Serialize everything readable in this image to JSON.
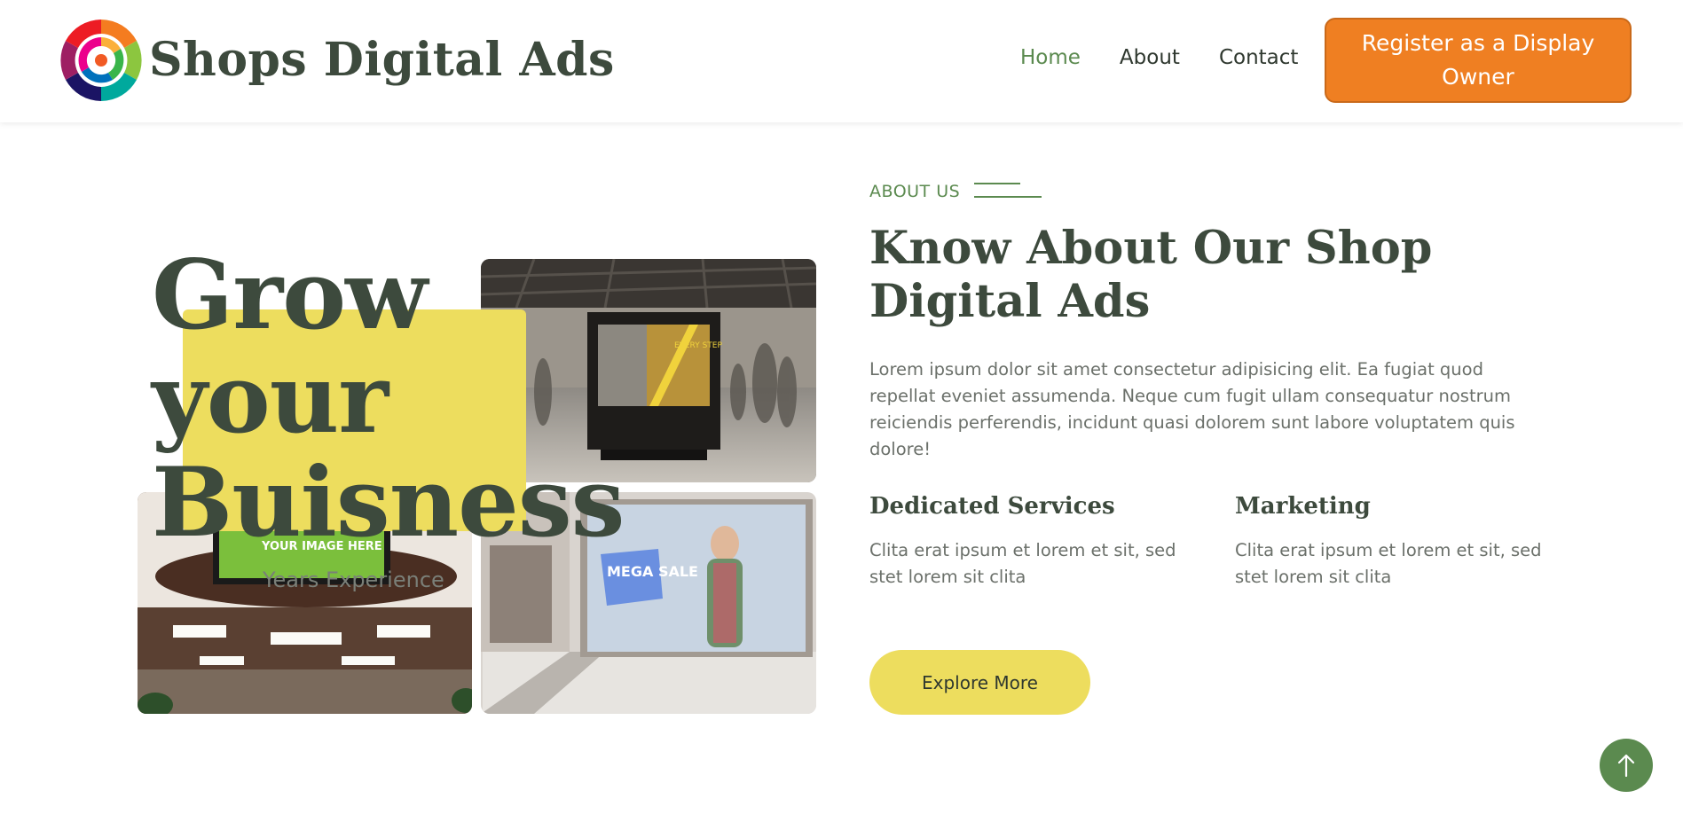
{
  "header": {
    "brand": "Shops Digital Ads",
    "logo_icon": "swirl-logo-icon",
    "nav": [
      {
        "label": "Home",
        "active": true
      },
      {
        "label": "About",
        "active": false
      },
      {
        "label": "Contact",
        "active": false
      }
    ],
    "register_label": "Register as a Display Owner"
  },
  "hero": {
    "big_text": "Grow your Buisness",
    "years_text": "Years Experience",
    "images": [
      {
        "name": "subway-billboard-image",
        "overlay_text": "EVERY STEP"
      },
      {
        "name": "mall-ceiling-screen-image",
        "overlay_text": "YOUR IMAGE HERE"
      },
      {
        "name": "mall-mega-sale-display-image",
        "overlay_text": "MEGA SALE"
      }
    ]
  },
  "about": {
    "label": "ABOUT US",
    "heading": "Know About Our Shop Digital Ads",
    "lead": "Lorem ipsum dolor sit amet consectetur adipisicing elit. Ea fugiat quod repellat eveniet assumenda. Neque cum fugit ullam consequatur nostrum reiciendis perferendis, incidunt quasi dolorem sunt labore voluptatem quis dolore!",
    "features": [
      {
        "title": "Dedicated Services",
        "text": "Clita erat ipsum et lorem et sit, sed stet lorem sit clita"
      },
      {
        "title": "Marketing",
        "text": "Clita erat ipsum et lorem et sit, sed stet lorem sit clita"
      }
    ],
    "cta_label": "Explore More"
  },
  "scroll_top_icon": "arrow-up-icon",
  "colors": {
    "accent_green": "#5b8a4f",
    "accent_orange": "#ef7f22",
    "accent_yellow": "#eddd5e",
    "text_dark": "#3d4a3d"
  }
}
